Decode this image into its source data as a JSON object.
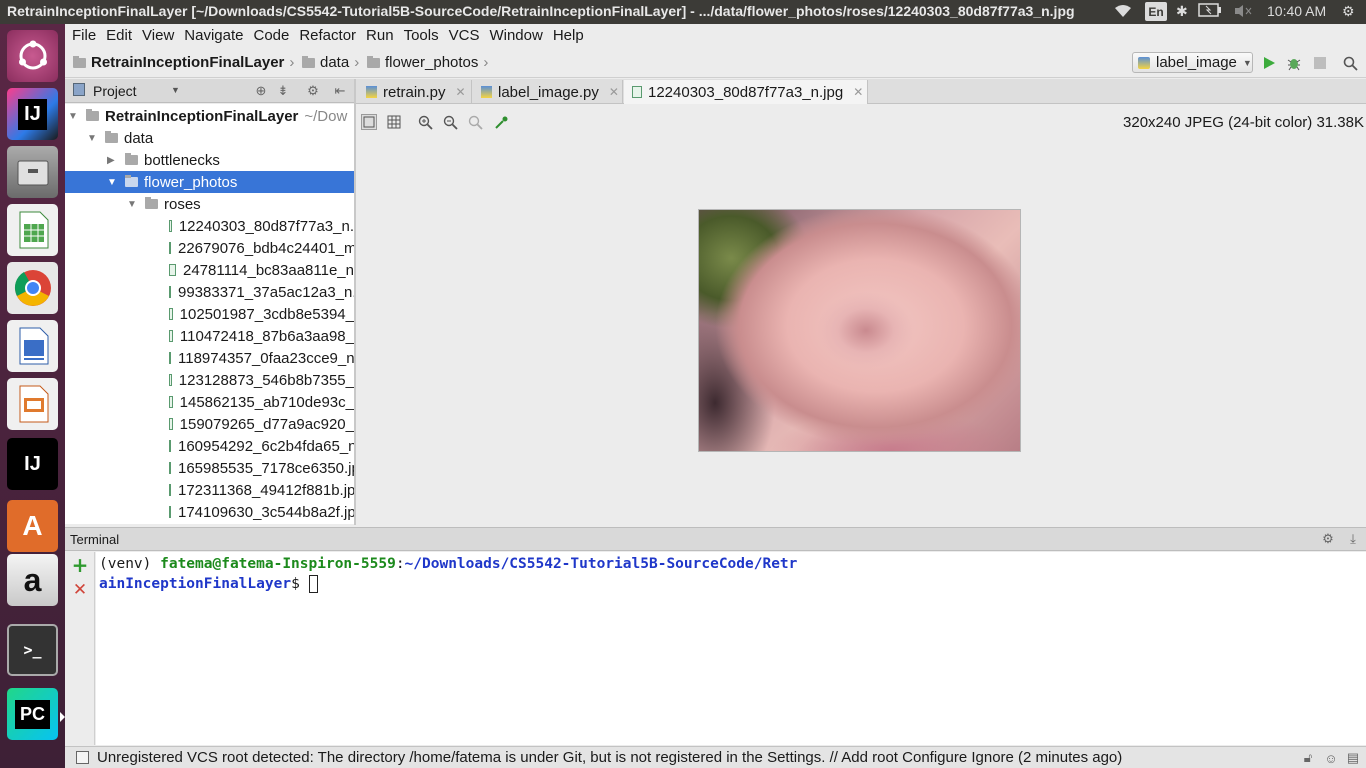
{
  "topbar": {
    "window_title": "RetrainInceptionFinalLayer [~/Downloads/CS5542-Tutorial5B-SourceCode/RetrainInceptionFinalLayer] - .../data/flower_photos/roses/12240303_80d87f77a3_n.jpg",
    "lang": "En",
    "time": "10:40 AM"
  },
  "launcher": {
    "items": [
      {
        "name": "ubuntu-dash",
        "label": ""
      },
      {
        "name": "intellij-idea",
        "label": "IJ"
      },
      {
        "name": "files",
        "label": ""
      },
      {
        "name": "libreoffice-calc",
        "label": ""
      },
      {
        "name": "chrome",
        "label": ""
      },
      {
        "name": "libreoffice-writer",
        "label": ""
      },
      {
        "name": "libreoffice-impress",
        "label": ""
      },
      {
        "name": "intellij-idea-2",
        "label": "IJ"
      },
      {
        "name": "software-center",
        "label": "A"
      },
      {
        "name": "amazon",
        "label": "a"
      },
      {
        "name": "terminal",
        "label": ">_"
      },
      {
        "name": "pycharm",
        "label": "PC"
      }
    ]
  },
  "menu": [
    "File",
    "Edit",
    "View",
    "Navigate",
    "Code",
    "Refactor",
    "Run",
    "Tools",
    "VCS",
    "Window",
    "Help"
  ],
  "breadcrumb": {
    "project": "RetrainInceptionFinalLayer",
    "data": "data",
    "flower_photos": "flower_photos"
  },
  "run_config": "label_image",
  "project_panel": {
    "title": "Project",
    "root_label": "RetrainInceptionFinalLayer",
    "root_path": "~/Dow",
    "data": "data",
    "bottlenecks": "bottlenecks",
    "flower_photos": "flower_photos",
    "roses": "roses",
    "files": [
      "12240303_80d87f77a3_n.",
      "22679076_bdb4c24401_m",
      "24781114_bc83aa811e_n",
      "99383371_37a5ac12a3_n.",
      "102501987_3cdb8e5394_",
      "110472418_87b6a3aa98_",
      "118974357_0faa23cce9_n",
      "123128873_546b8b7355_",
      "145862135_ab710de93c_",
      "159079265_d77a9ac920_",
      "160954292_6c2b4fda65_n",
      "165985535_7178ce6350.jp",
      "172311368_49412f881b.jp",
      "174109630_3c544b8a2f.jp"
    ]
  },
  "tabs": [
    {
      "label": "retrain.py"
    },
    {
      "label": "label_image.py"
    },
    {
      "label": "12240303_80d87f77a3_n.jpg"
    }
  ],
  "image_info": "320x240 JPEG (24-bit color) 31.38K",
  "terminal": {
    "title": "Terminal",
    "venv": "(venv) ",
    "user_host": "fatema@fatema-Inspiron-5559",
    "colon": ":",
    "path_line1": "~/Downloads/CS5542-Tutorial5B-SourceCode/Retr",
    "path_line2": "ainInceptionFinalLayer",
    "prompt": "$ "
  },
  "status": {
    "message": "Unregistered VCS root detected: The directory /home/fatema is under Git, but is not registered in the Settings. // Add root  Configure  Ignore (2 minutes ago)"
  }
}
